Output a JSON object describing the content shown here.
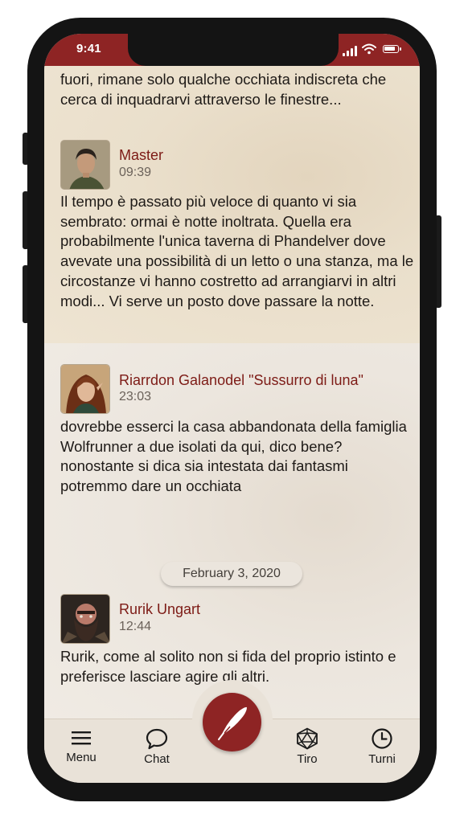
{
  "status_bar": {
    "time": "9:41"
  },
  "messages": [
    {
      "author": "",
      "time": "",
      "text": "fuori, rimane solo qualche occhiata indiscreta che cerca di inquadrarvi attraverso le finestre..."
    },
    {
      "author": "Master",
      "time": "09:39",
      "text": "Il tempo è passato più veloce di quanto vi sia sembrato: ormai è notte inoltrata. Quella era probabilmente l'unica taverna di Phandelver dove avevate una possibilità di un letto o una stanza, ma le circostanze vi hanno costretto ad arrangiarvi in altri modi... Vi serve un posto dove passare la notte."
    },
    {
      "author": "Riarrdon Galanodel \"Sussurro di luna\"",
      "time": "23:03",
      "text": "dovrebbe esserci la casa abbandonata della famiglia Wolfrunner a due isolati da qui, dico bene? nonostante si dica sia intestata dai fantasmi potremmo dare un occhiata"
    },
    {
      "author": "Rurik Ungart",
      "time": "12:44",
      "text": "Rurik, come al solito non si fida del proprio istinto e preferisce lasciare agire gli altri."
    }
  ],
  "date_separator": "February 3, 2020",
  "nav": {
    "menu": "Menu",
    "chat": "Chat",
    "tiro": "Tiro",
    "turni": "Turni"
  },
  "icons": {
    "menu": "hamburger-icon",
    "chat": "chat-bubble-icon",
    "compose": "quill-feather-icon",
    "tiro": "d20-dice-icon",
    "turni": "clock-icon"
  },
  "colors": {
    "accent": "#8e2424",
    "author_name": "#7d1b16",
    "top_background": "#eadfcb",
    "bottom_background": "#ece6de"
  }
}
